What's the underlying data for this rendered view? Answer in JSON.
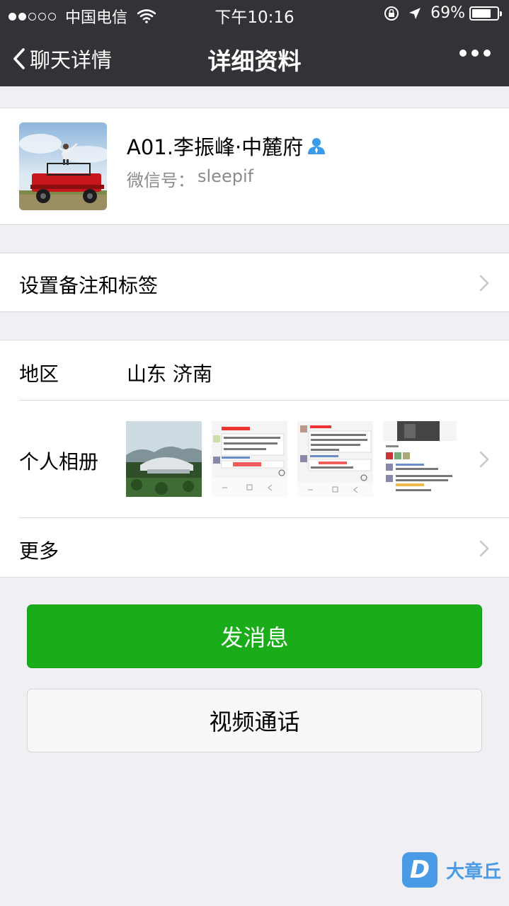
{
  "status_bar": {
    "carrier": "中国电信",
    "time": "下午10:16",
    "battery": "69%",
    "battery_level": 0.69,
    "signal_bars_filled": 2,
    "signal_bars_total": 5
  },
  "nav": {
    "back_label": "聊天详情",
    "title": "详细资料",
    "more_icon": "more-icon"
  },
  "profile": {
    "name": "A01.李振峰·中麓府",
    "wechat_id_label": "微信号：",
    "wechat_id": "sleepif"
  },
  "remark_row": {
    "label": "设置备注和标签"
  },
  "info": {
    "region_label": "地区",
    "region_value": "山东 济南",
    "album_label": "个人相册",
    "more_label": "更多"
  },
  "buttons": {
    "message": "发消息",
    "video_call": "视频通话"
  },
  "watermark": {
    "text": "大章丘"
  },
  "colors": {
    "nav_bg": "#333337",
    "primary_green": "#1aad19",
    "page_bg": "#efeff4",
    "contact_icon": "#3b9be8"
  }
}
